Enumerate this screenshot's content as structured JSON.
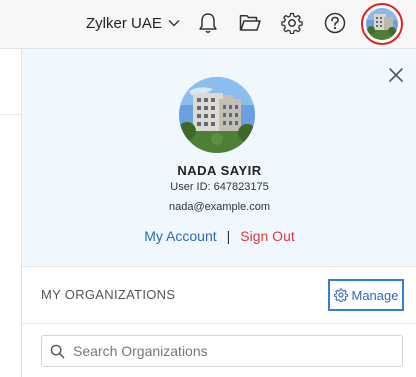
{
  "topbar": {
    "org_name": "Zylker UAE",
    "icons": [
      "chevron-down-icon",
      "bell-icon",
      "folder-icon",
      "gear-icon",
      "help-icon"
    ]
  },
  "profile": {
    "name": "NADA SAYIR",
    "user_id": "User ID: 647823175",
    "email": "nada@example.com",
    "my_account_label": "My Account",
    "separator": "|",
    "sign_out_label": "Sign Out"
  },
  "organizations": {
    "title": "MY ORGANIZATIONS",
    "manage_label": "Manage",
    "search_placeholder": "Search Organizations"
  },
  "colors": {
    "accent_blue": "#2d6bb8",
    "sign_out_red": "#e0393e",
    "highlight_red": "#e02020",
    "highlight_blue": "#2f80e0",
    "profile_bg": "#f0f7fd"
  }
}
